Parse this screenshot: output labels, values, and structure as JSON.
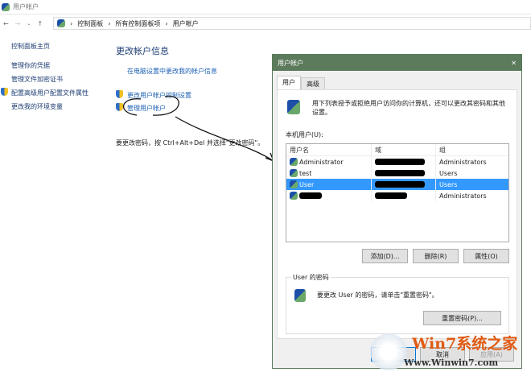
{
  "window": {
    "title": "用户帐户"
  },
  "breadcrumb": [
    "控制面板",
    "所有控制面板项",
    "用户帐户"
  ],
  "sidebar": {
    "items": [
      "控制面板主页",
      "管理你的凭据",
      "管理文件加密证书",
      "配置高级用户配置文件属性",
      "更改我的环境变量"
    ]
  },
  "main": {
    "heading": "更改帐户信息",
    "link_pc_settings": "在电脑设置中更改我的帐户信息",
    "link_uac": "更改用户帐户控制设置",
    "link_manage": "管理用户帐户",
    "hint": "要更改密码，按 Ctrl+Alt+Del 并选择\"更改密码\"。"
  },
  "dialog": {
    "title": "用户帐户",
    "close": "✕",
    "tabs": [
      "用户",
      "高级"
    ],
    "intro": "用下列表授予或拒绝用户访问你的计算机，还可以更改其密码和其他设置。",
    "list_label": "本机用户(U):",
    "columns": [
      "用户名",
      "域",
      "组"
    ],
    "rows": [
      {
        "name": "Administrator",
        "group": "Administrators"
      },
      {
        "name": "test",
        "group": "Users"
      },
      {
        "name": "User",
        "group": "Users",
        "selected": true
      },
      {
        "name": "",
        "group": "Administrators"
      }
    ],
    "buttons": {
      "add": "添加(D)...",
      "remove": "删除(R)",
      "properties": "属性(O)",
      "reset": "重置密码(P)...",
      "ok": "确定",
      "cancel": "取消",
      "apply": "应用(A)"
    },
    "password_group": "User 的密码",
    "password_text": "要更改 User 的密码，请单击\"重置密码\"。"
  },
  "watermark": {
    "brand": "Win7系统之家",
    "url": "Www.Winwin7.com"
  }
}
